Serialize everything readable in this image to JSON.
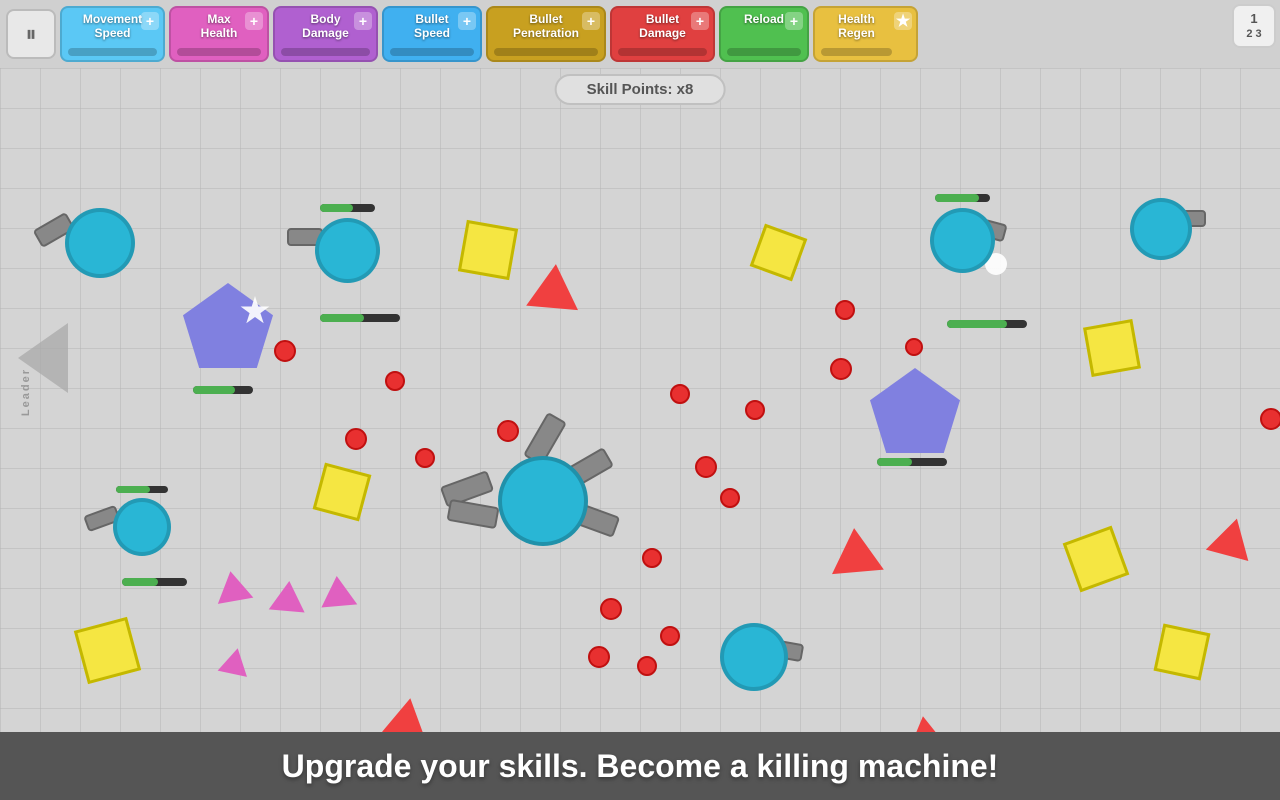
{
  "topbar": {
    "pause_label": "⏸",
    "skills": [
      {
        "id": "movement-speed",
        "label": "Movement\nSpeed",
        "color": "#5bc8f5",
        "bar_color": "#29a0d0",
        "fill": 0
      },
      {
        "id": "max-health",
        "label": "Max\nHealth",
        "color": "#e060c0",
        "bar_color": "#c030a0",
        "fill": 0
      },
      {
        "id": "body-damage",
        "label": "Body\nDamage",
        "color": "#c060e0",
        "bar_color": "#a030c0",
        "fill": 0
      },
      {
        "id": "bullet-speed",
        "label": "Bullet\nSpeed",
        "color": "#40b0f0",
        "bar_color": "#2090d0",
        "fill": 0
      },
      {
        "id": "bullet-penetration",
        "label": "Bullet\nPenetration",
        "color": "#d0b030",
        "bar_color": "#b09010",
        "fill": 0
      },
      {
        "id": "bullet-damage",
        "label": "Bullet\nDamage",
        "color": "#e04040",
        "bar_color": "#c02020",
        "fill": 0
      },
      {
        "id": "reload",
        "label": "Reload",
        "color": "#50c050",
        "bar_color": "#309030",
        "fill": 0
      },
      {
        "id": "health-regen",
        "label": "Health\nRegen",
        "color": "#f0c040",
        "bar_color": "#d0a020",
        "fill": 0
      }
    ],
    "level_badge": "1\n2 3"
  },
  "skill_points": {
    "label": "Skill Points: x8"
  },
  "bottom_banner": {
    "text": "Upgrade your skills. Become a killing machine!"
  },
  "leader": {
    "text": "Leader"
  }
}
